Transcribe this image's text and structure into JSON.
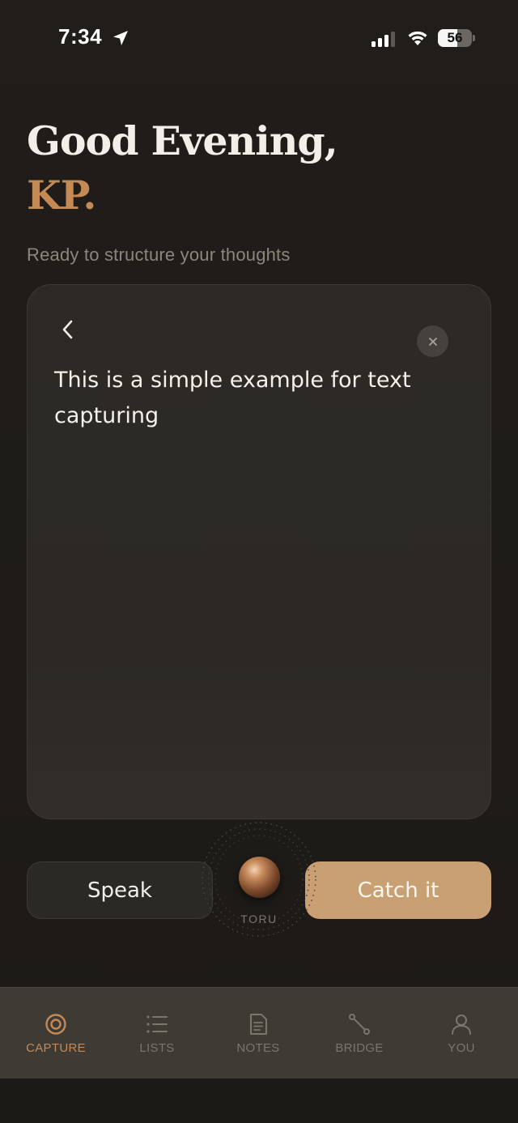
{
  "status_bar": {
    "time": "7:34",
    "battery_level": "56",
    "battery_fraction": 0.56
  },
  "greeting": {
    "line1": "Good Evening,",
    "name": "KP.",
    "subtitle": "Ready to structure your thoughts"
  },
  "capture_card": {
    "text": "This is a simple example for text capturing",
    "back_icon": "chevron-left-icon",
    "close_icon": "close-icon"
  },
  "actions": {
    "speak_label": "Speak",
    "catch_label": "Catch it",
    "orb_label": "TORU"
  },
  "tabs": [
    {
      "label": "CAPTURE",
      "icon": "target-icon",
      "active": true
    },
    {
      "label": "LISTS",
      "icon": "list-icon",
      "active": false
    },
    {
      "label": "NOTES",
      "icon": "document-icon",
      "active": false
    },
    {
      "label": "BRIDGE",
      "icon": "bridge-icon",
      "active": false
    },
    {
      "label": "YOU",
      "icon": "person-icon",
      "active": false
    }
  ],
  "colors": {
    "background": "#1f1c19",
    "accent": "#c48a55",
    "primary_button": "#c8a073",
    "card": "#2d2a26",
    "tab_bar": "#3e3a34"
  }
}
